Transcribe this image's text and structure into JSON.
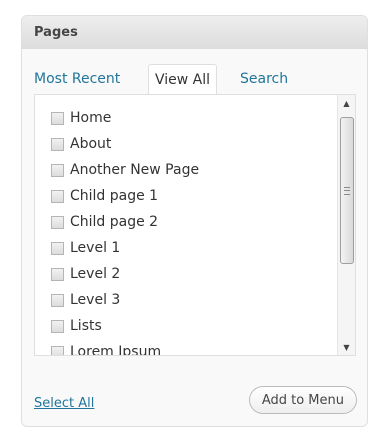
{
  "panel": {
    "title": "Pages"
  },
  "tabs": {
    "most_recent": "Most Recent",
    "view_all": "View All",
    "search": "Search",
    "active": "View All"
  },
  "pages": {
    "items": [
      {
        "label": "Home",
        "checked": false
      },
      {
        "label": "About",
        "checked": false
      },
      {
        "label": "Another New Page",
        "checked": false
      },
      {
        "label": "Child page 1",
        "checked": false
      },
      {
        "label": "Child page 2",
        "checked": false
      },
      {
        "label": "Level 1",
        "checked": false
      },
      {
        "label": "Level 2",
        "checked": false
      },
      {
        "label": "Level 3",
        "checked": false
      },
      {
        "label": "Lists",
        "checked": false
      },
      {
        "label": "Lorem Ipsum",
        "checked": false
      }
    ]
  },
  "footer": {
    "select_all": "Select All",
    "add_to_menu": "Add to Menu"
  },
  "icons": {
    "scroll_up": "scroll-up-arrow-icon",
    "scroll_down": "scroll-down-arrow-icon",
    "scroll_grip": "scroll-grip-icon"
  },
  "colors": {
    "link": "#21759b",
    "header_bg": "#e4e4e4",
    "panel_bg": "#f9f9f9"
  }
}
